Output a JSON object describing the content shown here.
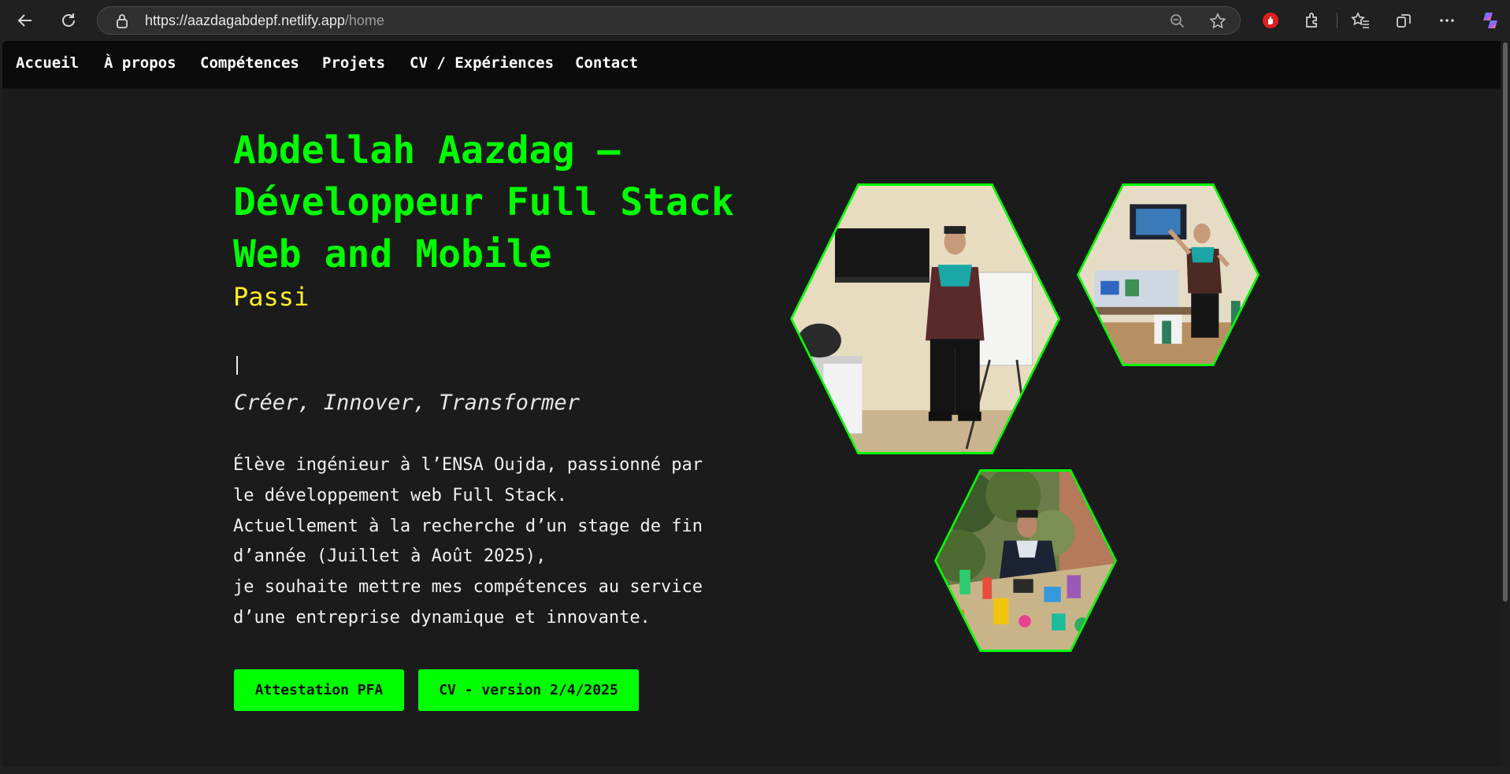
{
  "browser": {
    "url_host": "https://aazdagabdepf.netlify.app",
    "url_path": "/home",
    "icons": [
      "back-arrow-icon",
      "refresh-icon",
      "lock-icon",
      "zoom-out-icon",
      "star-icon",
      "adblock-icon",
      "extensions-icon",
      "favorites-icon",
      "collections-icon",
      "more-icon",
      "copilot-icon"
    ]
  },
  "nav": {
    "items": [
      "Accueil",
      "À propos",
      "Compétences",
      "Projets",
      "CV / Expériences",
      "Contact"
    ]
  },
  "hero": {
    "title": "Abdellah Aazdag – Développeur Full Stack Web and Mobile",
    "subtitle": "Passi",
    "tagline": "Créer, Innover, Transformer",
    "description": [
      "Élève ingénieur à l’ENSA Oujda, passionné par le développement web Full Stack.",
      "Actuellement à la recherche d’un stage de fin d’année (Juillet à Août 2025),",
      "je souhaite mettre mes compétences au service d’une entreprise dynamique et innovante."
    ],
    "buttons": [
      "Attestation PFA",
      "CV - version 2/4/2025"
    ]
  },
  "colors": {
    "accent": "#00ff00",
    "subtitle": "#ffef29",
    "background": "#1b1b1b",
    "nav_background": "#0b0b0b"
  }
}
